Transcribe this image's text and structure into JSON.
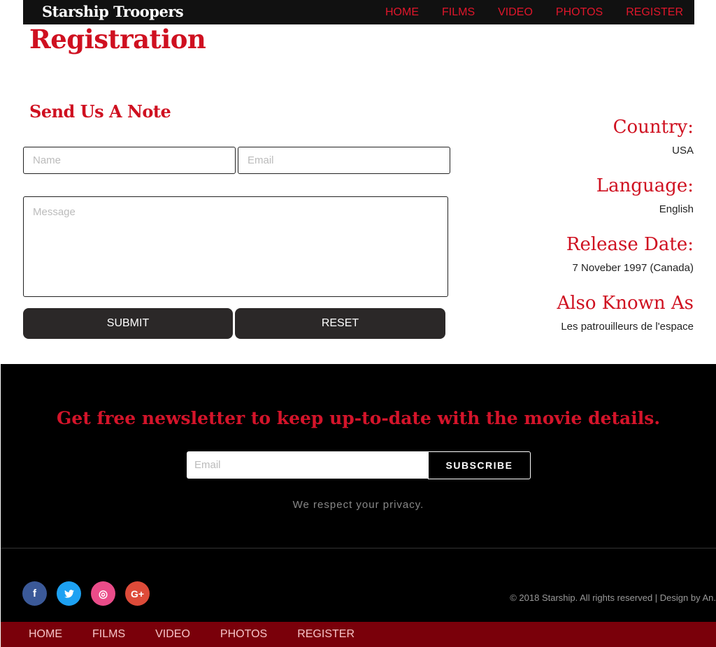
{
  "header": {
    "brand": "Starship Troopers",
    "nav": [
      "HOME",
      "FILMS",
      "VIDEO",
      "PHOTOS",
      "REGISTER"
    ]
  },
  "page_title": "Registration",
  "form": {
    "title": "Send Us A Note",
    "name_placeholder": "Name",
    "email_placeholder": "Email",
    "message_placeholder": "Message",
    "submit_label": "SUBMIT",
    "reset_label": "RESET"
  },
  "info": {
    "country_label": "Country:",
    "country_value": "USA",
    "language_label": "Language:",
    "language_value": "English",
    "release_label": "Release Date:",
    "release_value": "7 Noveber 1997 (Canada)",
    "aka_label": "Also Known As",
    "aka_value": "Les patrouilleurs de l'espace"
  },
  "newsletter": {
    "heading": "Get free newsletter to keep up-to-date with the movie details.",
    "email_placeholder": "Email",
    "subscribe_label": "SUBSCRIBE",
    "privacy": "We respect your privacy."
  },
  "footer": {
    "social": [
      {
        "icon": "facebook-icon",
        "glyph": "f"
      },
      {
        "icon": "twitter-icon",
        "glyph": "t"
      },
      {
        "icon": "dribbble-icon",
        "glyph": "◎"
      },
      {
        "icon": "google-plus-icon",
        "glyph": "G+"
      }
    ],
    "copyright": "© 2018 Starship. All rights reserved | Design by An."
  },
  "bottom_nav": [
    "HOME",
    "FILMS",
    "VIDEO",
    "PHOTOS",
    "REGISTER"
  ],
  "colors": {
    "accent_red": "#cf1020",
    "bottom_bar": "#7a000a",
    "button_dark": "#2b2828"
  }
}
